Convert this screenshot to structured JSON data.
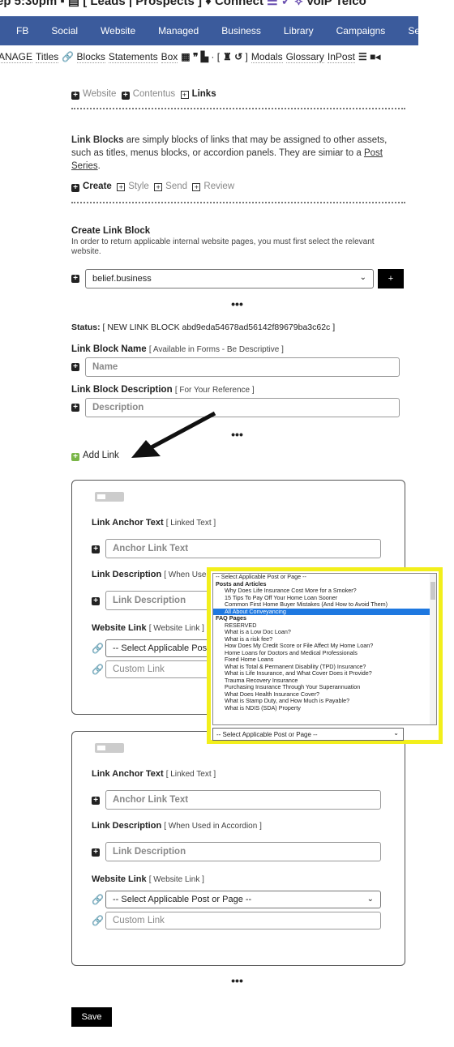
{
  "topbar": {
    "text": "ep 5:30pm",
    "leads": "[ Leads",
    "prospects": "| Prospects ]",
    "connect": "Connect",
    "voip": "VoIP Telco"
  },
  "nav": [
    "FB",
    "Social",
    "Website",
    "Managed",
    "Business",
    "Library",
    "Campaigns",
    "Settings"
  ],
  "subnav": {
    "manage": "ANAGE",
    "items": [
      "Titles",
      "Blocks",
      "Statements",
      "Box"
    ],
    "bracket_open": "· [",
    "bracket_close": "]",
    "items2": [
      "Modals",
      "Glossary",
      "InPost"
    ]
  },
  "crumbs": [
    {
      "label": "Website"
    },
    {
      "label": "Contentus"
    },
    {
      "label": "Links"
    }
  ],
  "intro": {
    "bold": "Link Blocks",
    "text": " are simply blocks of links that may be assigned to other assets, such as titles, menus blocks, or accordion panels. They are simiar to a ",
    "link": "Post Series",
    "end": "."
  },
  "steps": [
    {
      "label": "Create"
    },
    {
      "label": "Style"
    },
    {
      "label": "Send"
    },
    {
      "label": "Review"
    }
  ],
  "create": {
    "title": "Create Link Block",
    "desc": "In order to return applicable internal website pages, you must first select the relevant website.",
    "website": "belief.business",
    "add": "+"
  },
  "ellipsis": "•••",
  "status": {
    "label": "Status:",
    "value": "[ NEW LINK BLOCK abd9eda54678ad56142f89679ba3c62c ]"
  },
  "name": {
    "label": "Link Block Name",
    "hint": "[ Available in Forms - Be Descriptive ]",
    "placeholder": "Name"
  },
  "description": {
    "label": "Link Block Description",
    "hint": "[ For Your Reference ]",
    "placeholder": "Description"
  },
  "add_link": "Add Link",
  "link_card": {
    "anchor_label": "Link Anchor Text",
    "anchor_hint": "[ Linked Text ]",
    "anchor_placeholder": "Anchor Link Text",
    "desc_label": "Link Description",
    "desc_hint": "[ When Used in Accordion ]",
    "desc_hint_short": "[ When Used",
    "desc_placeholder": "Link Description",
    "web_label": "Website Link",
    "web_hint": "[ Website Link ]",
    "select": "-- Select Applicable Post or Page --",
    "select_short": "-- Select Applicable Pos",
    "custom_placeholder": "Custom Link"
  },
  "dropdown": {
    "first": "-- Select Applicable Post or Page --",
    "groups": [
      {
        "label": "Posts and Articles",
        "options": [
          "Why Does Life Insurance Cost More for a Smoker?",
          "15 Tips To Pay Off Your Home Loan Sooner",
          "Common First Home Buyer Mistakes (And How to Avoid Them)",
          "All About Conveyancing"
        ]
      },
      {
        "label": "FAQ Pages",
        "options": [
          "RESERVED",
          "What is a Low Doc Loan?",
          "What is a risk fee?",
          "How Does My Credit Score or File Affect My Home Loan?",
          "Home Loans for Doctors and Medical Professionals",
          "Fixed Home Loans",
          "What is Total & Permanent Disability (TPD) Insurance?",
          "What is Life Insurance, and What Cover Does it Provide?",
          "Trauma Recovery Insurance",
          "Purchasing Insurance Through Your Superannuation",
          "What Does Health Insurance Cover?",
          "What is Stamp Duty, and How Much is Payable?",
          "What is NDIS (SDA) Property"
        ]
      }
    ],
    "highlighted": "All About Conveyancing",
    "selected": "-- Select Applicable Post or Page --"
  },
  "save": "Save",
  "colors": {
    "nav": "#3b5b9c",
    "highlight_border": "#f2ef1b",
    "option_highlight": "#1e78e0",
    "add_link_icon": "#7ab648"
  }
}
